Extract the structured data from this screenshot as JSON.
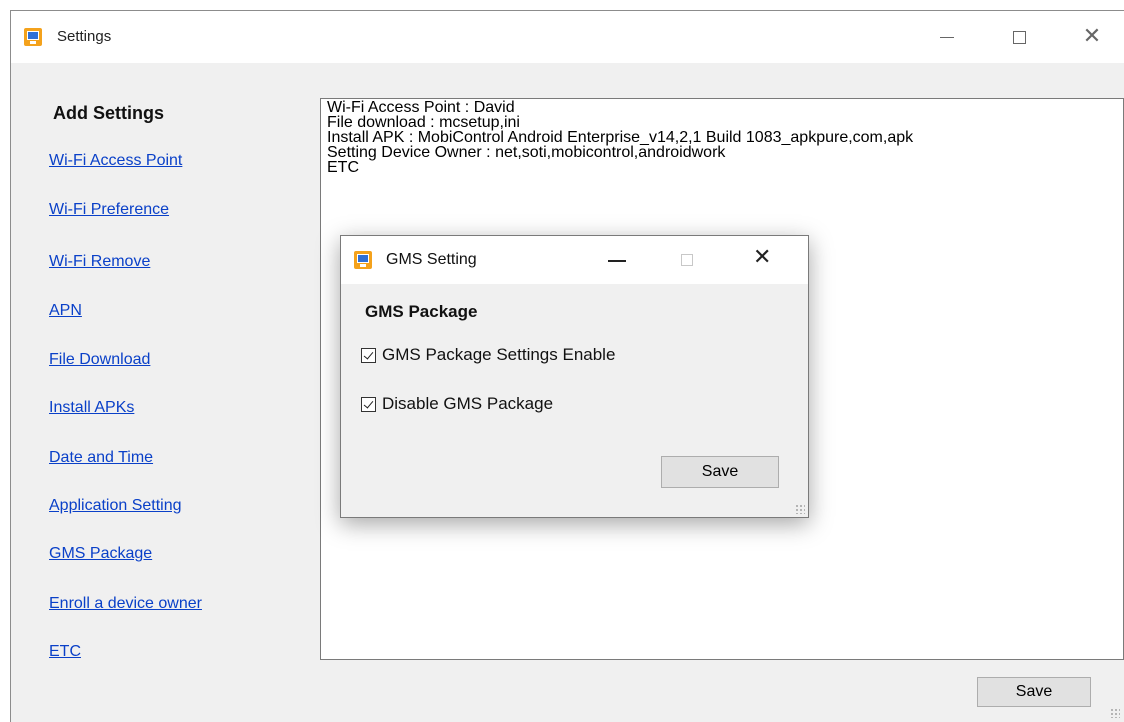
{
  "window": {
    "title": "Settings",
    "icon": "app-monitor-icon"
  },
  "sidebar": {
    "title": "Add Settings",
    "items": [
      {
        "label": "Wi-Fi Access Point"
      },
      {
        "label": "Wi-Fi Preference"
      },
      {
        "label": "Wi-Fi Remove"
      },
      {
        "label": "APN"
      },
      {
        "label": "File Download"
      },
      {
        "label": "Install APKs"
      },
      {
        "label": "Date and Time"
      },
      {
        "label": "Application Setting"
      },
      {
        "label": "GMS Package"
      },
      {
        "label": "Enroll a device owner"
      },
      {
        "label": "ETC"
      }
    ]
  },
  "log": {
    "lines": [
      "Wi-Fi Access Point : David",
      "File download : mcsetup,ini",
      "Install APK : MobiControl Android Enterprise_v14,2,1 Build 1083_apkpure,com,apk",
      "Setting Device Owner : net,soti,mobicontrol,androidwork",
      "ETC"
    ]
  },
  "footer": {
    "save_label": "Save"
  },
  "dialog": {
    "title": "GMS Setting",
    "heading": "GMS Package",
    "options": [
      {
        "label": "GMS Package Settings Enable",
        "checked": true
      },
      {
        "label": "Disable GMS Package",
        "checked": true
      }
    ],
    "save_label": "Save"
  }
}
